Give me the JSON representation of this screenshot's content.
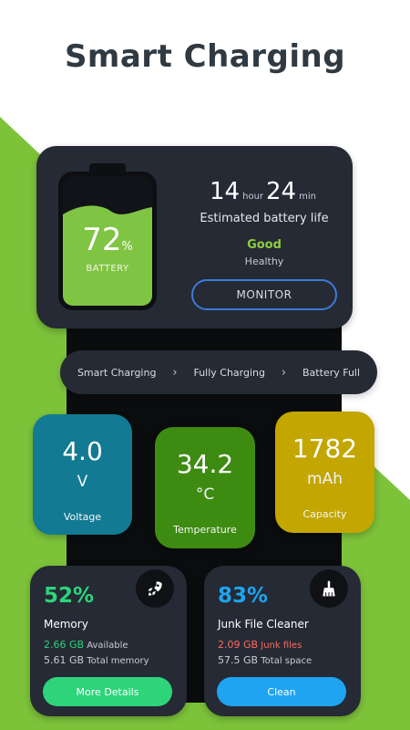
{
  "headline": "Smart Charging",
  "colors": {
    "green_bg": "#7dc33a",
    "card_dark": "#252a35",
    "battery_fill": "#80c443",
    "voltage_tile": "#127a92",
    "temperature_tile": "#3e8b11",
    "capacity_tile": "#c3a600",
    "memory_accent": "#2ed47a",
    "junk_accent": "#1ea4f0",
    "junk_highlight": "#ff6b5e"
  },
  "battery": {
    "percent": "72",
    "percent_symbol": "%",
    "level": 0.72,
    "label": "BATTERY",
    "hours": "14",
    "hours_unit": "hour",
    "minutes": "24",
    "minutes_unit": "min",
    "estimated_label": "Estimated battery life",
    "health_status": "Good",
    "health_label": "Healthy",
    "monitor_button": "MONITOR"
  },
  "charging_steps": [
    "Smart Charging",
    "Fully Charging",
    "Battery Full"
  ],
  "stats": {
    "voltage": {
      "value": "4.0",
      "unit": "V",
      "label": "Voltage"
    },
    "temperature": {
      "value": "34.2",
      "unit": "°C",
      "label": "Temperature"
    },
    "capacity": {
      "value": "1782",
      "unit": "mAh",
      "label": "Capacity"
    }
  },
  "memory": {
    "percent": "52%",
    "title": "Memory",
    "available_value": "2.66 GB",
    "available_label": "Available",
    "total_value": "5.61 GB",
    "total_label": "Total memory",
    "button": "More Details",
    "icon": "rocket-icon"
  },
  "junk": {
    "percent": "83%",
    "title": "Junk File Cleaner",
    "junk_value": "2.09 GB",
    "junk_label": "Junk files",
    "total_value": "57.5 GB",
    "total_label": "Total space",
    "button": "Clean",
    "icon": "broom-icon"
  }
}
